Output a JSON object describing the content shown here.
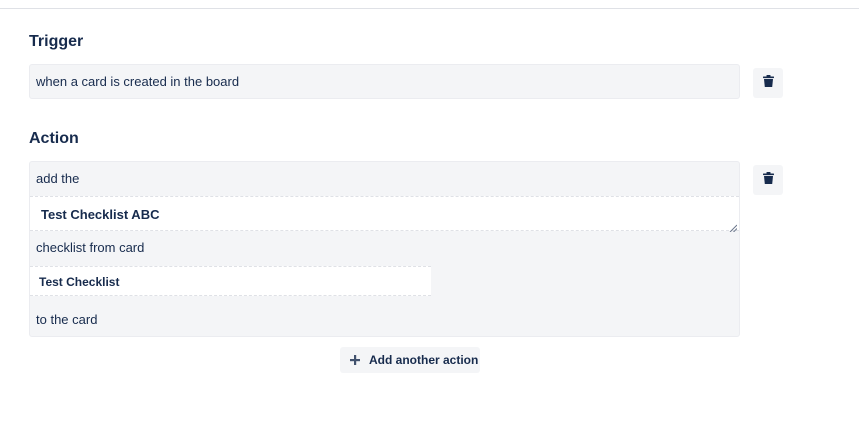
{
  "trigger": {
    "heading": "Trigger",
    "text": "when a card is created in the board"
  },
  "action": {
    "heading": "Action",
    "prefix": "add the",
    "checklist_name_value": "Test Checklist ABC",
    "middle": "checklist from card",
    "card_value": "Test Checklist",
    "suffix": "to the card"
  },
  "buttons": {
    "add_another_action": "Add another action"
  },
  "icons": {
    "delete": "trash-icon",
    "add": "plus-icon"
  },
  "colors": {
    "text": "#172b4d",
    "box_bg": "#f4f5f7",
    "border": "#dfe1e6"
  }
}
